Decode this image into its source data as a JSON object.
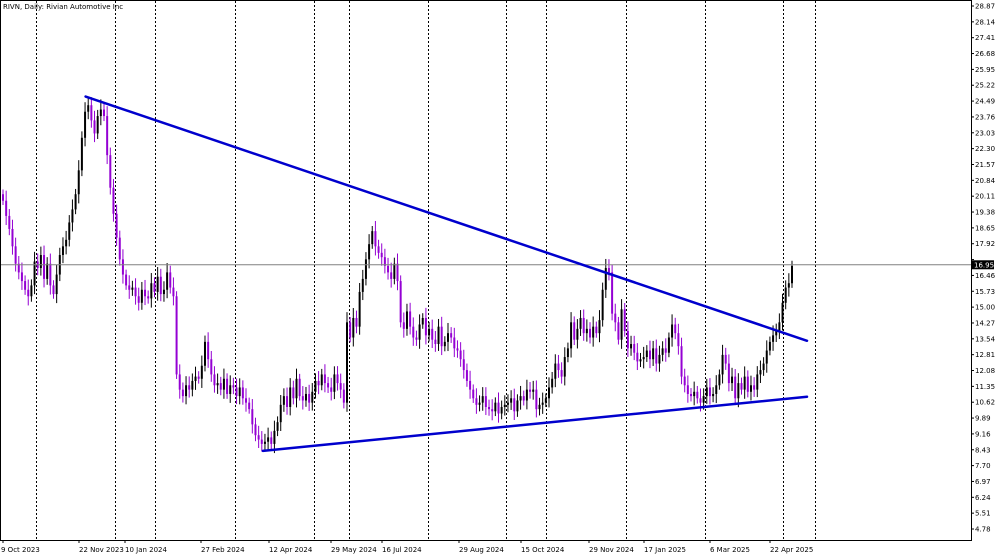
{
  "chart_data": {
    "type": "candlestick",
    "title": "RIVN, Daily:  Rivian Automotive Inc",
    "price_ticks": [
      "28.87",
      "28.14",
      "27.41",
      "26.68",
      "25.95",
      "25.22",
      "24.49",
      "23.76",
      "23.03",
      "22.30",
      "21.57",
      "20.84",
      "20.11",
      "19.38",
      "18.65",
      "17.92",
      "17.19",
      "16.46",
      "15.73",
      "15.00",
      "14.27",
      "13.54",
      "12.81",
      "12.08",
      "11.35",
      "10.62",
      "9.89",
      "9.16",
      "8.43",
      "7.70",
      "6.97",
      "6.24",
      "5.51",
      "4.78"
    ],
    "ylim": [
      4.53,
      29.11
    ],
    "current_price": "16.95",
    "date_ticks": [
      "9 Oct 2023",
      "22 Nov 2023",
      "10 Jan 2024",
      "27 Feb 2024",
      "12 Apr 2024",
      "29 May 2024",
      "16 Jul 2024",
      "29 Aug 2024",
      "15 Oct 2024",
      "29 Nov 2024",
      "17 Jan 2025",
      "6 Mar 2025",
      "22 Apr 2025"
    ],
    "grid": true,
    "colors": {
      "up_candle": "#000000",
      "down_candle": "#9400d3",
      "trendline": "#0000cd",
      "grid": "#000000",
      "price_line": "#808080",
      "price_label_bg": "#000000",
      "price_label_text": "#ffffff"
    },
    "close_series": [
      19.9,
      19.2,
      18.6,
      17.8,
      17.0,
      16.6,
      16.2,
      15.8,
      15.5,
      16.0,
      17.1,
      16.8,
      17.4,
      16.3,
      17.0,
      16.0,
      15.6,
      16.5,
      17.4,
      17.8,
      18.1,
      18.9,
      19.5,
      20.2,
      21.3,
      22.8,
      24.0,
      24.3,
      23.6,
      23.0,
      23.8,
      24.1,
      23.8,
      22.0,
      20.5,
      19.3,
      18.2,
      17.2,
      16.5,
      16.0,
      15.8,
      15.9,
      15.5,
      15.2,
      15.8,
      15.5,
      15.4,
      16.1,
      15.7,
      16.4,
      15.6,
      15.8,
      16.6,
      15.9,
      15.5,
      11.9,
      11.2,
      10.9,
      11.4,
      11.2,
      11.6,
      11.8,
      11.7,
      12.3,
      13.4,
      12.6,
      11.9,
      11.4,
      11.5,
      11.2,
      11.7,
      11.0,
      11.4,
      11.3,
      10.9,
      11.3,
      10.8,
      10.6,
      10.3,
      9.6,
      9.1,
      8.9,
      8.7,
      8.8,
      9.0,
      8.7,
      9.3,
      9.7,
      10.5,
      10.9,
      10.4,
      11.3,
      10.8,
      11.7,
      10.9,
      10.7,
      11.0,
      10.6,
      11.1,
      11.6,
      11.4,
      11.9,
      11.5,
      11.3,
      11.1,
      11.9,
      11.5,
      11.2,
      10.6,
      14.3,
      13.6,
      14.5,
      14.1,
      15.7,
      16.3,
      17.2,
      17.9,
      18.5,
      17.8,
      17.5,
      17.3,
      16.9,
      16.6,
      16.3,
      17.0,
      16.2,
      14.3,
      14.0,
      14.8,
      14.1,
      13.6,
      13.5,
      14.2,
      14.5,
      13.7,
      14.0,
      13.5,
      13.3,
      14.1,
      13.2,
      13.4,
      13.8,
      13.6,
      13.1,
      13.0,
      12.6,
      12.1,
      11.6,
      11.2,
      10.8,
      10.5,
      10.6,
      10.9,
      10.4,
      10.3,
      10.2,
      10.6,
      10.1,
      10.4,
      10.5,
      10.6,
      10.8,
      10.2,
      10.7,
      10.9,
      10.7,
      11.2,
      11.1,
      11.2,
      10.3,
      10.5,
      10.6,
      10.8,
      11.3,
      11.7,
      12.4,
      12.1,
      11.8,
      12.7,
      13.1,
      14.3,
      13.5,
      14.0,
      14.5,
      13.8,
      14.0,
      13.6,
      14.1,
      13.8,
      14.4,
      15.8,
      16.8,
      16.6,
      14.7,
      14.3,
      13.5,
      14.9,
      13.9,
      13.1,
      13.3,
      12.9,
      12.5,
      12.6,
      12.7,
      13.0,
      12.6,
      13.1,
      12.4,
      12.8,
      13.1,
      12.9,
      13.6,
      14.2,
      13.8,
      13.2,
      11.8,
      11.4,
      11.0,
      10.9,
      11.1,
      10.8,
      10.6,
      10.9,
      11.3,
      10.9,
      11.0,
      11.4,
      11.9,
      12.8,
      12.4,
      11.5,
      11.8,
      10.8,
      11.5,
      11.2,
      11.8,
      11.1,
      11.4,
      11.2,
      11.9,
      12.1,
      12.4,
      13.0,
      13.4,
      13.7,
      13.9,
      14.3,
      15.2,
      15.9,
      16.1,
      16.9
    ],
    "trendlines": [
      {
        "name": "upper",
        "from": [
          "29 Nov 2023",
          24.7
        ],
        "to": [
          "21 May 2025",
          13.45
        ]
      },
      {
        "name": "lower",
        "from": [
          "8 Apr 2024",
          8.38
        ],
        "to": [
          "21 May 2025",
          10.87
        ]
      }
    ]
  }
}
